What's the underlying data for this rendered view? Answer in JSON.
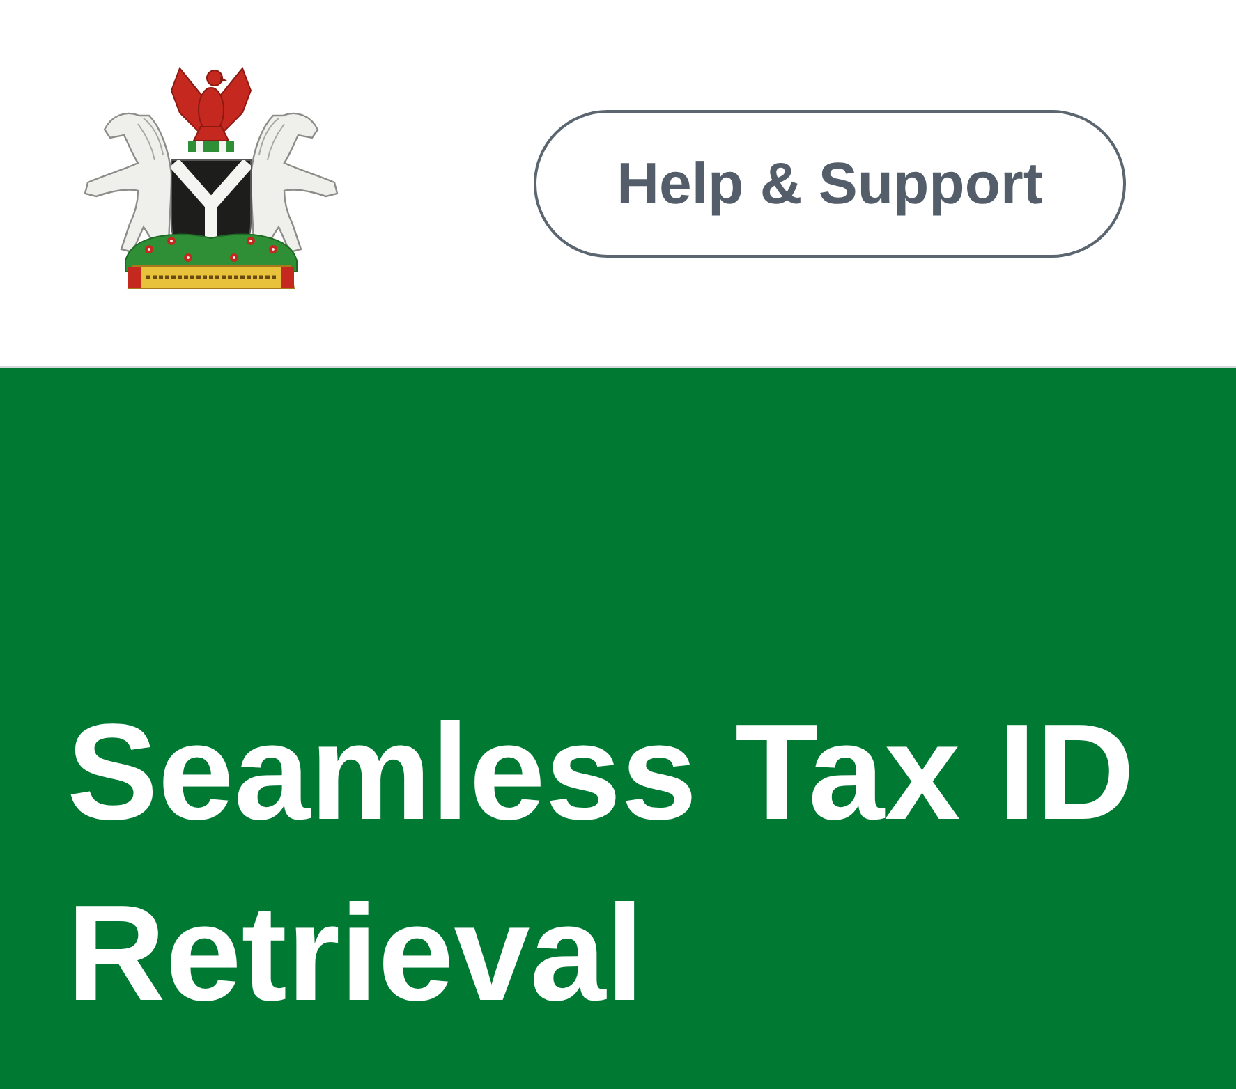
{
  "header": {
    "help_button": {
      "label": "Help & Support"
    }
  },
  "hero": {
    "title": "Seamless Tax ID Retrieval"
  }
}
